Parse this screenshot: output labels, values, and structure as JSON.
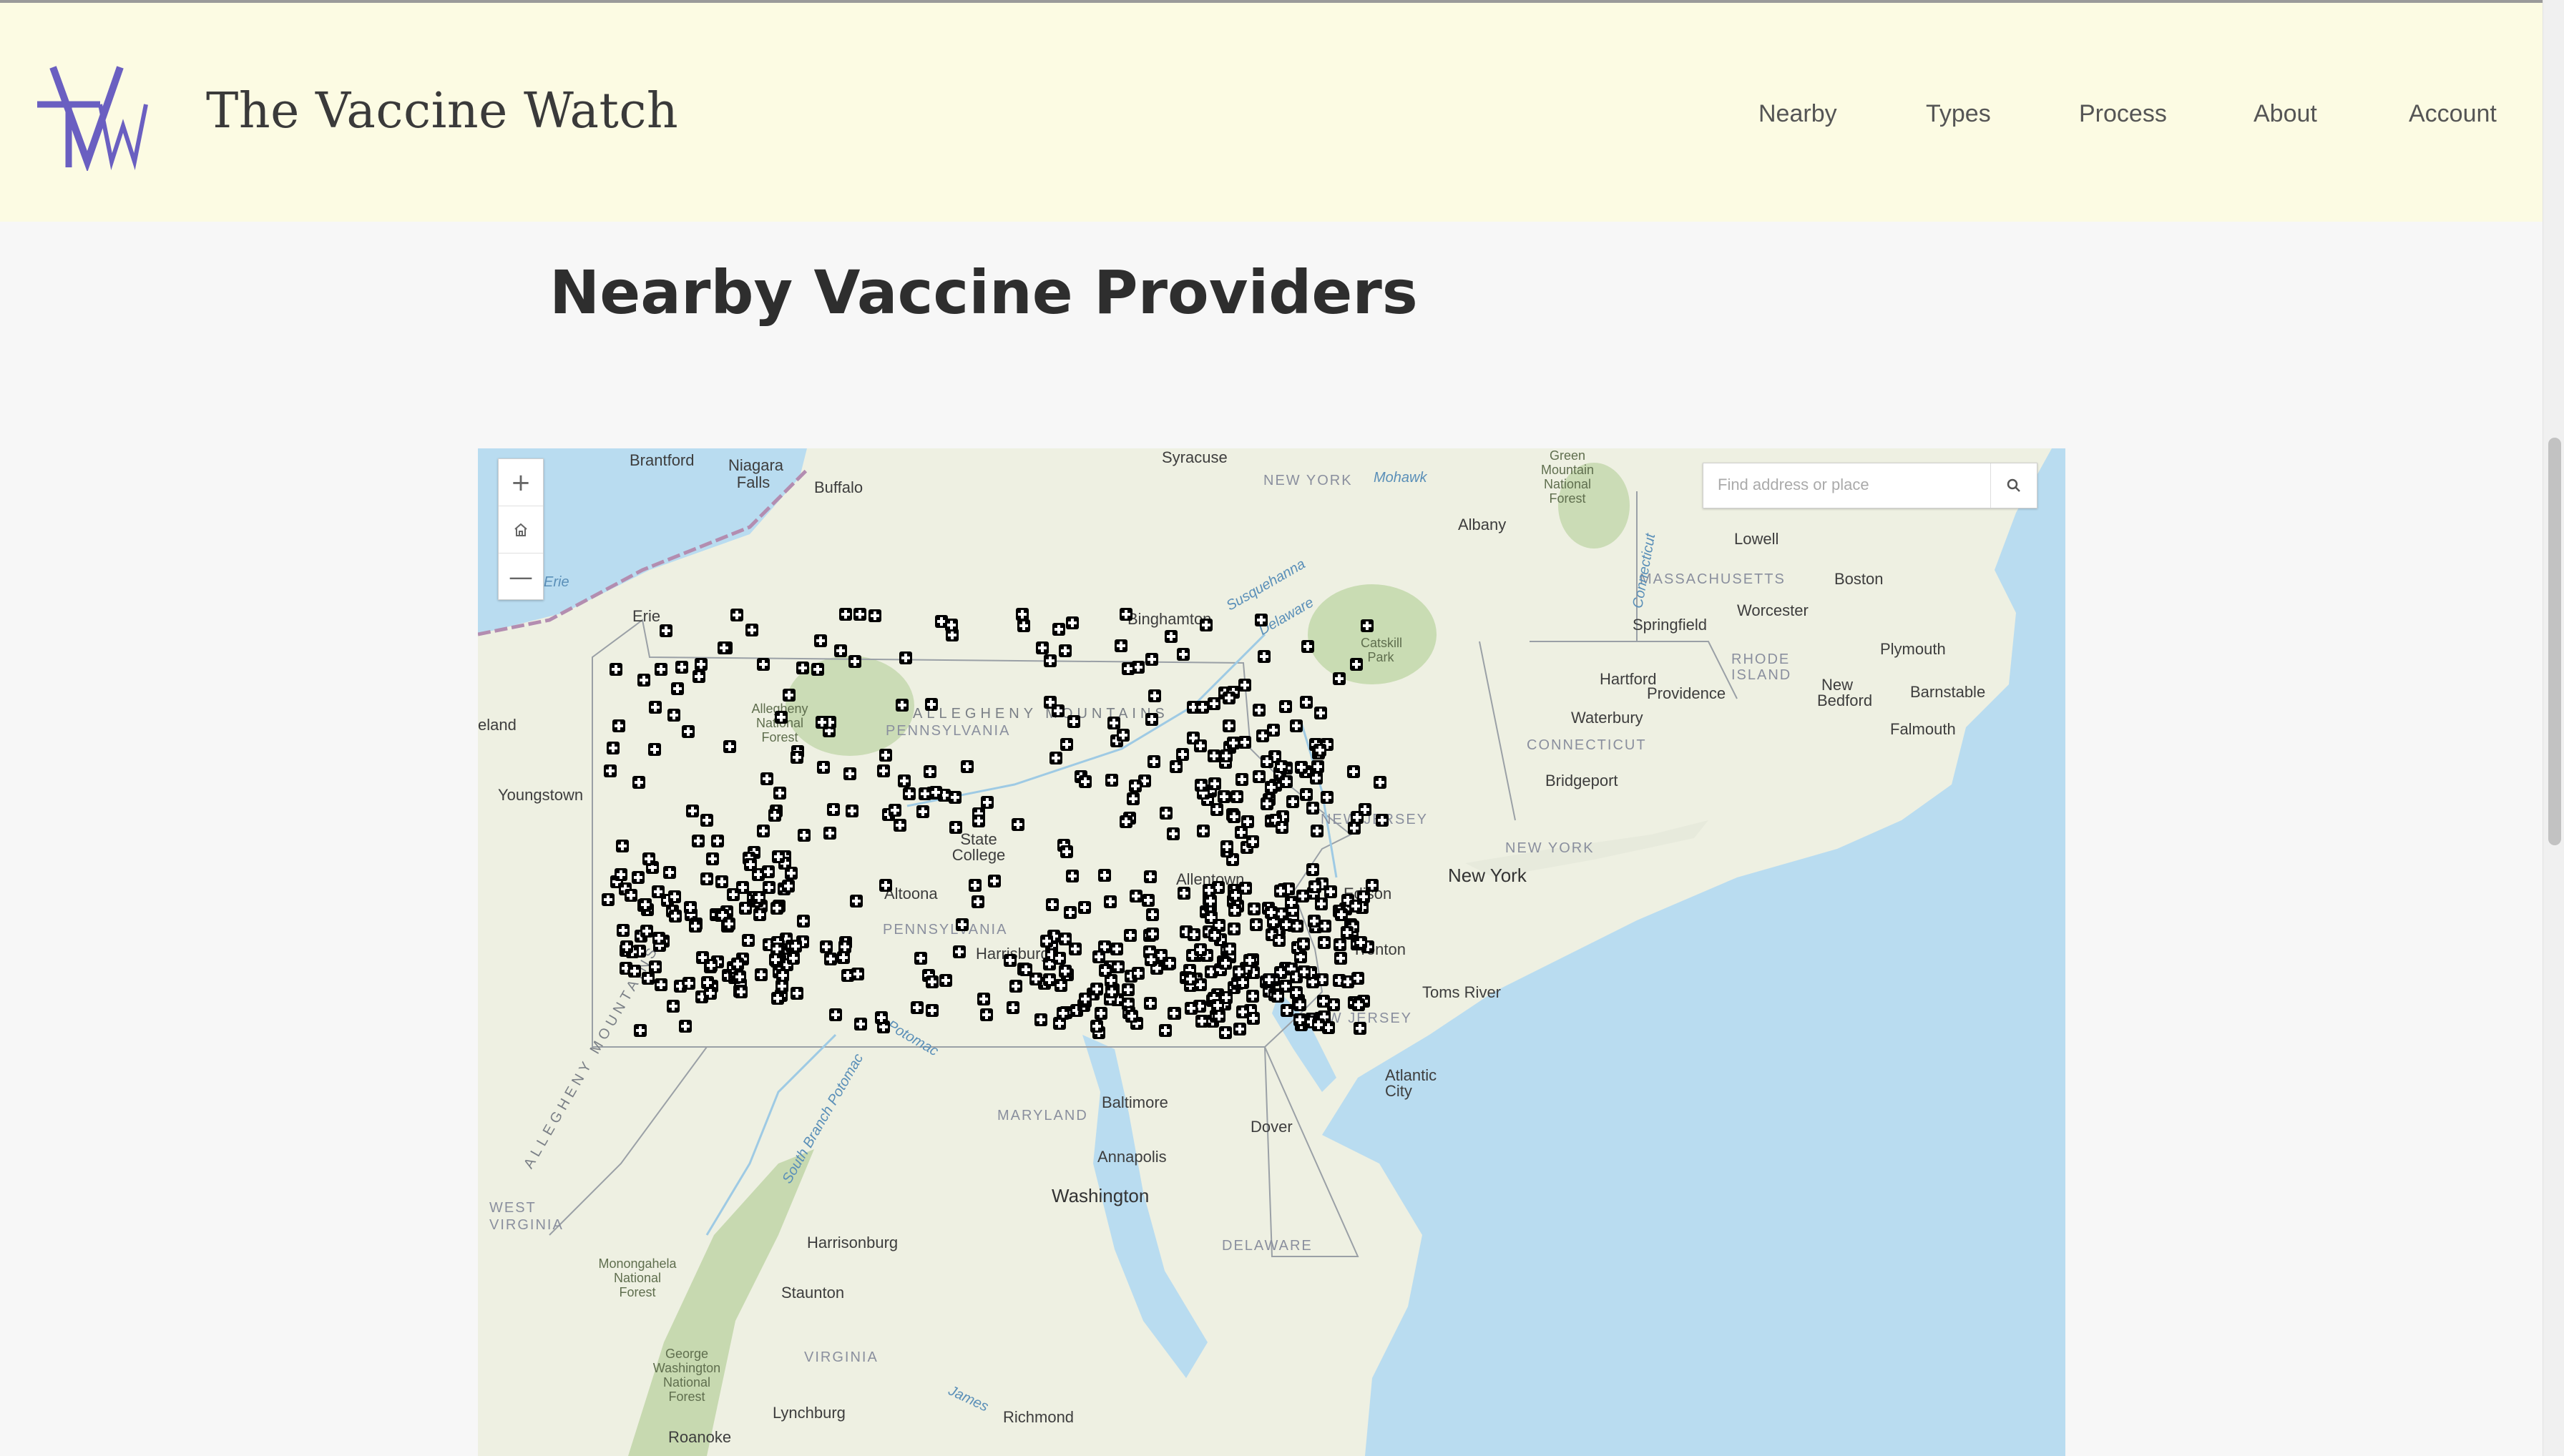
{
  "site": {
    "title": "The Vaccine Watch"
  },
  "nav": {
    "items": [
      {
        "label": "Nearby",
        "key": "nearby"
      },
      {
        "label": "Types",
        "key": "types"
      },
      {
        "label": "Process",
        "key": "process"
      },
      {
        "label": "About",
        "key": "about"
      },
      {
        "label": "Account",
        "key": "account"
      }
    ]
  },
  "page": {
    "heading": "Nearby Vaccine Providers"
  },
  "map": {
    "search_placeholder": "Find address or place",
    "controls": {
      "zoom_in": "+",
      "zoom_out": "—"
    },
    "labels": {
      "cities": [
        "Brantford",
        "Niagara Falls",
        "Buffalo",
        "Syracuse",
        "Albany",
        "Lowell",
        "Boston",
        "Worcester",
        "Springfield",
        "Erie",
        "Binghamton",
        "Hartford",
        "Providence",
        "Plymouth",
        "New Bedford",
        "Barnstable",
        "Falmouth",
        "Waterbury",
        "Bridgeport",
        "eland",
        "Youngstown",
        "State College",
        "Altoona",
        "Harrisburg",
        "Allentown",
        "Edison",
        "New York",
        "Trenton",
        "Toms River",
        "Atlantic City",
        "Baltimore",
        "Dover",
        "Annapolis",
        "Washington",
        "Harrisonburg",
        "Staunton",
        "Lynchburg",
        "Richmond",
        "Roanoke"
      ],
      "states": [
        "NEW YORK",
        "MASSACHUSETTS",
        "RHODE ISLAND",
        "CONNECTICUT",
        "PENNSYLVANIA",
        "NEW JERSEY",
        "MARYLAND",
        "DELAWARE",
        "WEST VIRGINIA",
        "VIRGINIA"
      ],
      "water": [
        "Erie",
        "Mohawk",
        "Susquehanna",
        "Delaware",
        "Connecticut",
        "Potomac",
        "South Branch Potomac",
        "James"
      ],
      "parks": [
        "Green Mountain National Forest",
        "Catskill Park",
        "Allegheny National Forest",
        "Monongahela National Forest",
        "George Washington National Forest"
      ],
      "ridges": [
        "ALLEGHENY MOUNTAINS",
        "ALLEGHENY MOUNTAINS"
      ]
    }
  },
  "colors": {
    "header_bg": "#fcfbe3",
    "logo_purple": "#6a5fc1",
    "marker": "#000000",
    "water": "#b9dcf0"
  },
  "icons": {
    "search": "search-icon",
    "home": "home-icon",
    "marker": "medical-cross-icon"
  }
}
